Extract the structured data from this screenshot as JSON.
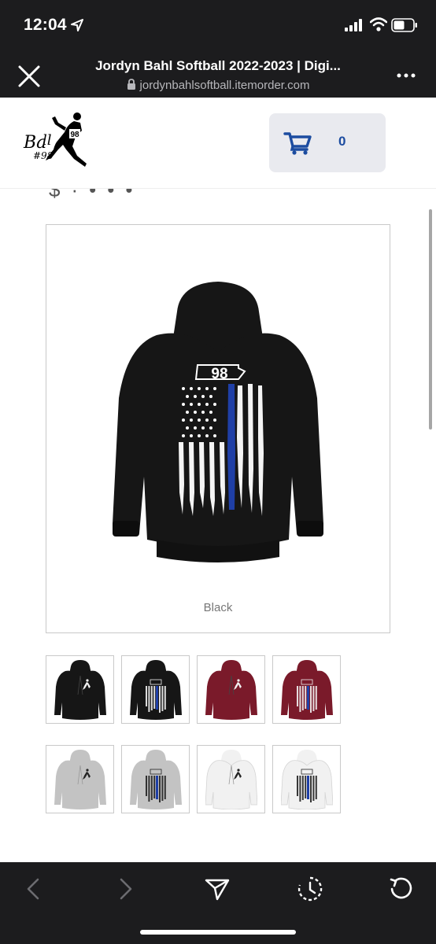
{
  "status_bar": {
    "time": "12:04"
  },
  "browser": {
    "title": "Jordyn Bahl Softball 2022-2023 | Digi...",
    "url": "jordynbahlsoftball.itemorder.com"
  },
  "header": {
    "logo_text": "Bahl #98",
    "cart_count": "0"
  },
  "product": {
    "main_image_caption": "Black",
    "hoodie_number": "98",
    "thumbnails": [
      {
        "color": "black",
        "side": "front"
      },
      {
        "color": "black",
        "side": "back"
      },
      {
        "color": "maroon",
        "side": "front"
      },
      {
        "color": "maroon",
        "side": "back"
      },
      {
        "color": "gray",
        "side": "front"
      },
      {
        "color": "gray",
        "side": "back"
      },
      {
        "color": "white",
        "side": "front"
      },
      {
        "color": "white",
        "side": "back"
      }
    ]
  },
  "colors": {
    "chrome": "#1c1c1e",
    "cart_accent": "#1c4ca0",
    "cart_bg": "#e9eaef",
    "hoodie_black": "#161616",
    "hoodie_maroon": "#7a1a2a",
    "hoodie_gray": "#c3c3c3",
    "hoodie_white": "#f1f1f1",
    "thin_blue_line": "#1f3fa6"
  }
}
